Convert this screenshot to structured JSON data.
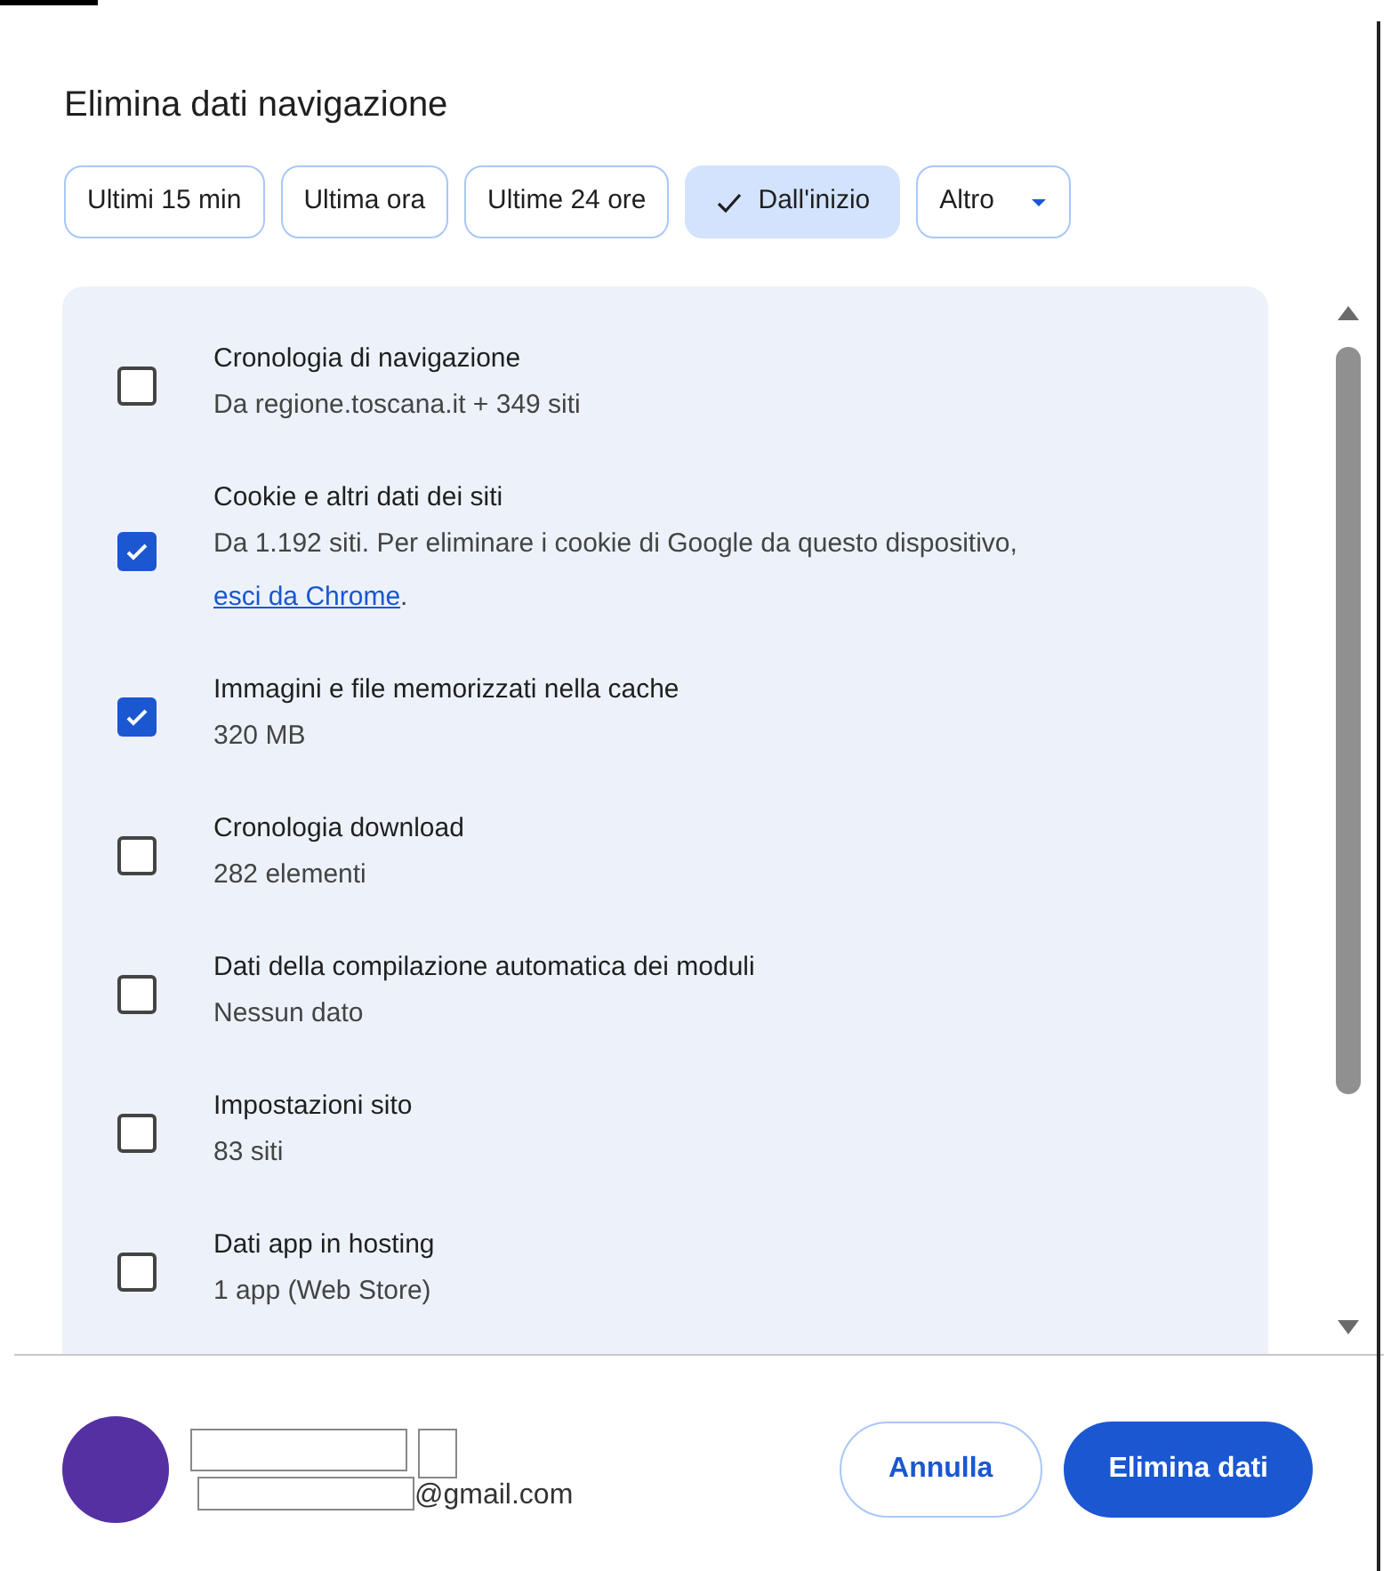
{
  "dialog": {
    "title": "Elimina dati navigazione"
  },
  "time_ranges": [
    {
      "label": "Ultimi 15 min",
      "selected": false,
      "kind": "chip"
    },
    {
      "label": "Ultima ora",
      "selected": false,
      "kind": "chip"
    },
    {
      "label": "Ultime 24 ore",
      "selected": false,
      "kind": "chip"
    },
    {
      "label": "Dall'inizio",
      "selected": true,
      "kind": "chip"
    },
    {
      "label": "Altro",
      "selected": false,
      "kind": "dropdown"
    }
  ],
  "items": [
    {
      "title": "Cronologia di navigazione",
      "description": "Da regione.toscana.it + 349 siti",
      "checked": false
    },
    {
      "title": "Cookie e altri dati dei siti",
      "description": "Da 1.192 siti. Per eliminare i cookie di Google da questo dispositivo,",
      "link": "esci da Chrome",
      "after_link": ".",
      "checked": true
    },
    {
      "title": "Immagini e file memorizzati nella cache",
      "description": "320 MB",
      "checked": true
    },
    {
      "title": "Cronologia download",
      "description": "282 elementi",
      "checked": false
    },
    {
      "title": "Dati della compilazione automatica dei moduli",
      "description": "Nessun dato",
      "checked": false
    },
    {
      "title": "Impostazioni sito",
      "description": "83 siti",
      "checked": false
    },
    {
      "title": "Dati app in hosting",
      "description": "1 app (Web Store)",
      "checked": false
    }
  ],
  "account": {
    "email": "@gmail.com"
  },
  "buttons": [
    {
      "label": "Annulla",
      "kind": "secondary"
    },
    {
      "label": "Elimina dati",
      "kind": "primary"
    }
  ]
}
